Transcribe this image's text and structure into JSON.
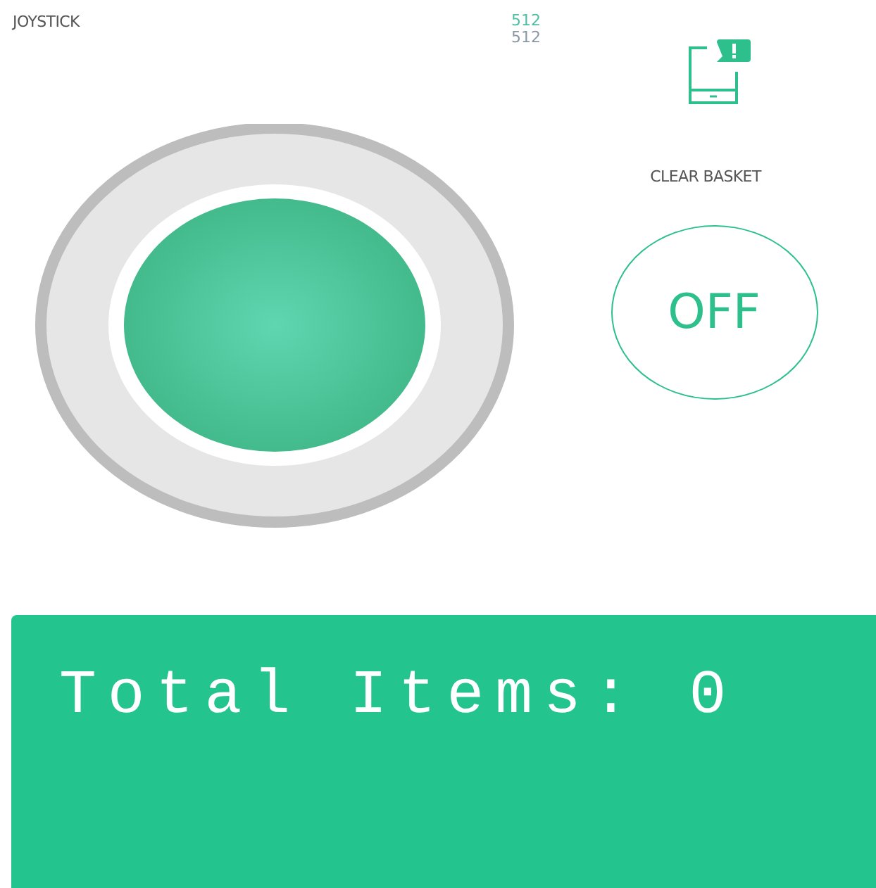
{
  "joystick": {
    "label": "JOYSTICK",
    "values": [
      {
        "text": "512",
        "color": "#4fbfa3"
      },
      {
        "text": "512",
        "color": "#8a98a6"
      }
    ]
  },
  "clear_basket": {
    "label": "CLEAR BASKET",
    "button": {
      "text": "OFF",
      "on": false
    }
  },
  "lcd": {
    "lines": [
      "Total Items: 0"
    ]
  }
}
